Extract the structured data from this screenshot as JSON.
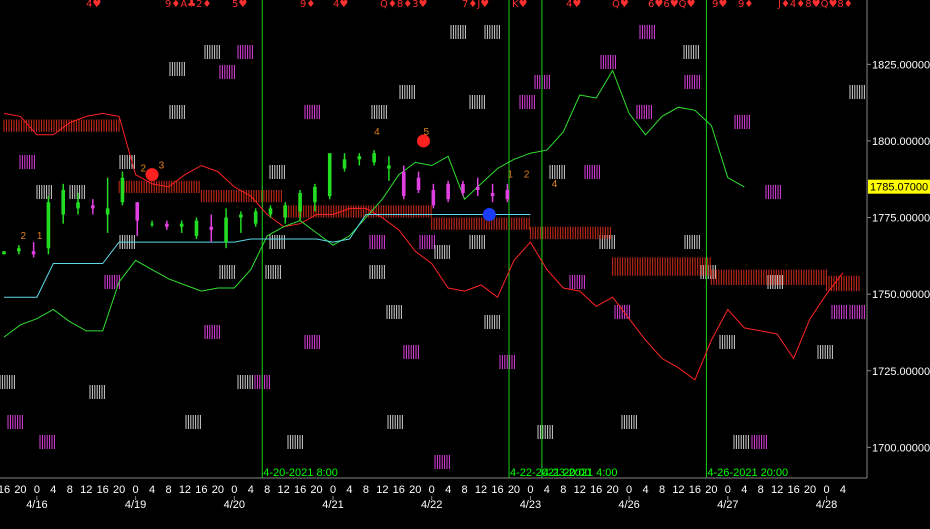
{
  "chart_data": {
    "type": "candlestick",
    "ylim": [
      1690,
      1846
    ],
    "y_ticks": [
      1700,
      1725,
      1750,
      1775,
      1800,
      1825
    ],
    "y_tick_labels": [
      "1700.00000",
      "1725.00000",
      "1750.00000",
      "1775.00000",
      "1800.00000",
      "1825.00000"
    ],
    "last_price": 1785.07,
    "last_price_label": "1785.07000",
    "x_hour_ticks": [
      "16",
      "20",
      "0",
      "4",
      "8",
      "12",
      "16",
      "20",
      "0",
      "4",
      "8",
      "12",
      "16",
      "20",
      "0",
      "4",
      "8",
      "12",
      "16",
      "20",
      "0",
      "4",
      "8",
      "12",
      "16",
      "20",
      "0",
      "4",
      "8",
      "12",
      "16",
      "20",
      "0",
      "4",
      "8",
      "12",
      "16",
      "20",
      "0",
      "4",
      "8",
      "12",
      "16",
      "20",
      "0",
      "4",
      "8",
      "12",
      "16",
      "20",
      "0",
      "4"
    ],
    "x_date_labels": [
      {
        "label": "4/16",
        "index": 2
      },
      {
        "label": "4/19",
        "index": 8
      },
      {
        "label": "4/20",
        "index": 14
      },
      {
        "label": "4/21",
        "index": 20
      },
      {
        "label": "4/22",
        "index": 26
      },
      {
        "label": "4/23",
        "index": 32
      },
      {
        "label": "4/26",
        "index": 38
      },
      {
        "label": "4/27",
        "index": 44
      },
      {
        "label": "4/28",
        "index": 50
      }
    ],
    "session_markers": [
      {
        "label": "4-20-2021 8:00",
        "index": 15.7
      },
      {
        "label": "4-22-2021 20:00",
        "index": 30.7
      },
      {
        "label": "4-23-2021 4:00",
        "index": 32.7
      },
      {
        "label": "4-26-2021 20:00",
        "index": 42.7
      }
    ],
    "candles": [
      {
        "o": 1763,
        "h": 1764,
        "l": 1763,
        "c": 1764
      },
      {
        "o": 1764,
        "h": 1766,
        "l": 1763,
        "c": 1765
      },
      {
        "o": 1764,
        "h": 1767,
        "l": 1762,
        "c": 1763
      },
      {
        "o": 1765,
        "h": 1782,
        "l": 1763,
        "c": 1780
      },
      {
        "o": 1776,
        "h": 1786,
        "l": 1773,
        "c": 1784
      },
      {
        "o": 1778,
        "h": 1783,
        "l": 1776,
        "c": 1780
      },
      {
        "o": 1779,
        "h": 1781,
        "l": 1776,
        "c": 1778
      },
      {
        "o": 1776,
        "h": 1788,
        "l": 1770,
        "c": 1778
      },
      {
        "o": 1780,
        "h": 1790,
        "l": 1779,
        "c": 1788
      },
      {
        "o": 1780,
        "h": 1780,
        "l": 1769,
        "c": 1774
      },
      {
        "o": 1773,
        "h": 1774,
        "l": 1772,
        "c": 1773
      },
      {
        "o": 1773,
        "h": 1774,
        "l": 1771,
        "c": 1772
      },
      {
        "o": 1772,
        "h": 1774,
        "l": 1770,
        "c": 1773
      },
      {
        "o": 1769,
        "h": 1775,
        "l": 1768,
        "c": 1774
      },
      {
        "o": 1772,
        "h": 1776,
        "l": 1767,
        "c": 1771
      },
      {
        "o": 1767,
        "h": 1778,
        "l": 1765,
        "c": 1775
      },
      {
        "o": 1775,
        "h": 1777,
        "l": 1770,
        "c": 1776
      },
      {
        "o": 1773,
        "h": 1778,
        "l": 1772,
        "c": 1777
      },
      {
        "o": 1776,
        "h": 1779,
        "l": 1775,
        "c": 1778
      },
      {
        "o": 1775,
        "h": 1780,
        "l": 1773,
        "c": 1779
      },
      {
        "o": 1777,
        "h": 1784,
        "l": 1774,
        "c": 1783
      },
      {
        "o": 1780,
        "h": 1786,
        "l": 1777,
        "c": 1785
      },
      {
        "o": 1782,
        "h": 1796,
        "l": 1781,
        "c": 1796
      },
      {
        "o": 1791,
        "h": 1796,
        "l": 1790,
        "c": 1794
      },
      {
        "o": 1794,
        "h": 1796,
        "l": 1792,
        "c": 1795
      },
      {
        "o": 1793,
        "h": 1797,
        "l": 1792,
        "c": 1796
      },
      {
        "o": 1791,
        "h": 1795,
        "l": 1787,
        "c": 1792
      },
      {
        "o": 1790,
        "h": 1792,
        "l": 1781,
        "c": 1782
      },
      {
        "o": 1788,
        "h": 1790,
        "l": 1783,
        "c": 1784
      },
      {
        "o": 1784,
        "h": 1786,
        "l": 1778,
        "c": 1779
      },
      {
        "o": 1786,
        "h": 1787,
        "l": 1780,
        "c": 1781
      },
      {
        "o": 1786,
        "h": 1787,
        "l": 1782,
        "c": 1783
      },
      {
        "o": 1785,
        "h": 1788,
        "l": 1782,
        "c": 1784
      },
      {
        "o": 1783,
        "h": 1786,
        "l": 1780,
        "c": 1782
      },
      {
        "o": 1784,
        "h": 1786,
        "l": 1780,
        "c": 1781
      }
    ],
    "red_line": [
      [
        0,
        1809
      ],
      [
        1,
        1808
      ],
      [
        2,
        1802
      ],
      [
        3,
        1802
      ],
      [
        4,
        1806
      ],
      [
        5,
        1808
      ],
      [
        6,
        1809
      ],
      [
        7,
        1808
      ],
      [
        8,
        1789
      ],
      [
        9,
        1786
      ],
      [
        10,
        1785
      ],
      [
        11,
        1789
      ],
      [
        12,
        1792
      ],
      [
        13,
        1790
      ],
      [
        14,
        1785
      ],
      [
        15,
        1782
      ],
      [
        16,
        1776
      ],
      [
        17,
        1772
      ],
      [
        18,
        1773
      ],
      [
        19,
        1776
      ],
      [
        20,
        1776
      ],
      [
        21,
        1778
      ],
      [
        22,
        1778
      ],
      [
        23,
        1775
      ],
      [
        24,
        1771
      ],
      [
        25,
        1764
      ],
      [
        26,
        1760
      ],
      [
        27,
        1752
      ],
      [
        28,
        1751
      ],
      [
        29,
        1753
      ],
      [
        30,
        1749
      ],
      [
        31,
        1761
      ],
      [
        32,
        1767
      ],
      [
        33,
        1758
      ],
      [
        34,
        1752
      ],
      [
        35,
        1751
      ],
      [
        36,
        1746
      ],
      [
        37,
        1749
      ],
      [
        38,
        1742
      ],
      [
        39,
        1735
      ],
      [
        40,
        1729
      ],
      [
        41,
        1726
      ],
      [
        42,
        1722
      ],
      [
        43,
        1735
      ],
      [
        44,
        1745
      ],
      [
        45,
        1739
      ],
      [
        46,
        1738
      ],
      [
        47,
        1737
      ],
      [
        48,
        1729
      ],
      [
        49,
        1742
      ],
      [
        50,
        1750
      ],
      [
        51,
        1757
      ]
    ],
    "green_line": [
      [
        0,
        1736
      ],
      [
        1,
        1740
      ],
      [
        2,
        1742
      ],
      [
        3,
        1745
      ],
      [
        4,
        1741
      ],
      [
        5,
        1738
      ],
      [
        6,
        1738
      ],
      [
        7,
        1754
      ],
      [
        8,
        1761
      ],
      [
        9,
        1758
      ],
      [
        10,
        1755
      ],
      [
        11,
        1753
      ],
      [
        12,
        1751
      ],
      [
        13,
        1752
      ],
      [
        14,
        1752
      ],
      [
        15,
        1758
      ],
      [
        16,
        1769
      ],
      [
        17,
        1772
      ],
      [
        18,
        1774
      ],
      [
        19,
        1770
      ],
      [
        20,
        1766
      ],
      [
        21,
        1769
      ],
      [
        22,
        1775
      ],
      [
        23,
        1781
      ],
      [
        24,
        1789
      ],
      [
        25,
        1793
      ],
      [
        26,
        1792
      ],
      [
        27,
        1795
      ],
      [
        28,
        1781
      ],
      [
        29,
        1786
      ],
      [
        30,
        1791
      ],
      [
        31,
        1794
      ],
      [
        32,
        1796
      ],
      [
        33,
        1797
      ],
      [
        34,
        1803
      ],
      [
        35,
        1815
      ],
      [
        36,
        1814
      ],
      [
        37,
        1823
      ],
      [
        38,
        1809
      ],
      [
        39,
        1802
      ],
      [
        40,
        1808
      ],
      [
        41,
        1811
      ],
      [
        42,
        1810
      ],
      [
        43,
        1805
      ],
      [
        44,
        1788
      ],
      [
        45,
        1785
      ]
    ],
    "cyan_line": [
      [
        0,
        1749
      ],
      [
        2,
        1749
      ],
      [
        3,
        1760
      ],
      [
        6,
        1760
      ],
      [
        7,
        1767
      ],
      [
        14,
        1767
      ],
      [
        15,
        1768
      ],
      [
        19,
        1768
      ],
      [
        20,
        1767
      ],
      [
        21,
        1768
      ],
      [
        22,
        1776
      ],
      [
        23,
        1776
      ],
      [
        32,
        1776
      ]
    ],
    "cloud_red": [
      {
        "x1": 0,
        "x2": 7,
        "top": 1807,
        "bot": 1803
      },
      {
        "x1": 7,
        "x2": 12,
        "top": 1787,
        "bot": 1783
      },
      {
        "x1": 12,
        "x2": 17,
        "top": 1784,
        "bot": 1780
      },
      {
        "x1": 17,
        "x2": 26,
        "top": 1779,
        "bot": 1775
      },
      {
        "x1": 26,
        "x2": 32,
        "top": 1775,
        "bot": 1771
      },
      {
        "x1": 32,
        "x2": 37,
        "top": 1772,
        "bot": 1768
      },
      {
        "x1": 37,
        "x2": 43,
        "top": 1762,
        "bot": 1756
      },
      {
        "x1": 43,
        "x2": 50,
        "top": 1758,
        "bot": 1753
      },
      {
        "x1": 50,
        "x2": 52,
        "top": 1756,
        "bot": 1751
      }
    ],
    "dots": [
      {
        "index": 9,
        "value": 1789,
        "color": "#ff2020"
      },
      {
        "index": 25.5,
        "value": 1800,
        "color": "#ff2020"
      },
      {
        "index": 29.5,
        "value": 1776,
        "color": "#1a3cff"
      }
    ],
    "count_labels": [
      {
        "text": "2",
        "index": 1,
        "value": 1768
      },
      {
        "text": "1",
        "index": 2,
        "value": 1768
      },
      {
        "text": "2",
        "index": 8.3,
        "value": 1790
      },
      {
        "text": "3",
        "index": 9.4,
        "value": 1791
      },
      {
        "text": "4",
        "index": 22.5,
        "value": 1802
      },
      {
        "text": "5",
        "index": 25.5,
        "value": 1802
      },
      {
        "text": "1",
        "index": 30.6,
        "value": 1788
      },
      {
        "text": "2",
        "index": 31.6,
        "value": 1788
      },
      {
        "text": "4",
        "index": 33.3,
        "value": 1785
      }
    ],
    "card_row": [
      "4♥",
      "9♦A♣2♦",
      "5♥",
      "9♦",
      "4♥",
      "Q♦8♦3♥",
      "7♦J♥",
      "K♥",
      "4♥",
      "Q♥",
      "6♥6♥Q♥",
      "9♥",
      "9♦",
      "J♦4♦8♥Q♥8♦"
    ]
  }
}
